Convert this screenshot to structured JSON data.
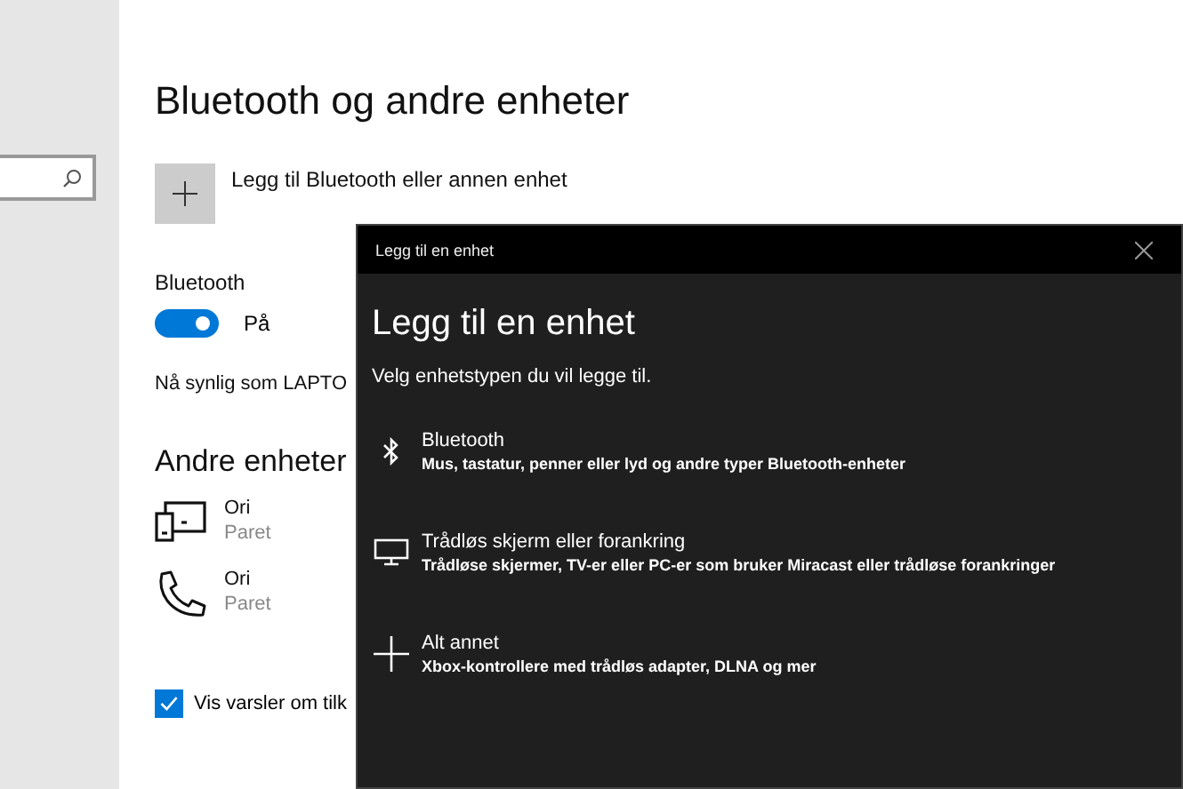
{
  "main": {
    "title": "Bluetooth og andre enheter",
    "add_device": {
      "label": "Legg til Bluetooth eller annen enhet"
    },
    "bluetooth": {
      "label": "Bluetooth",
      "on": true,
      "state_text": "På"
    },
    "visible_as": "Nå synlig som LAPTO",
    "other_devices": {
      "title": "Andre enheter",
      "items": [
        {
          "kind": "tablet",
          "name": "Ori",
          "status": "Paret"
        },
        {
          "kind": "phone",
          "name": "Ori",
          "status": "Paret"
        }
      ]
    },
    "notifications": {
      "label": "Vis varsler om tilk",
      "checked": true
    }
  },
  "dialog": {
    "title": "Legg til en enhet",
    "heading": "Legg til en enhet",
    "subtitle": "Velg enhetstypen du vil legge til.",
    "options": [
      {
        "kind": "bluetooth",
        "title": "Bluetooth",
        "description": "Mus, tastatur, penner eller lyd og andre typer Bluetooth-enheter"
      },
      {
        "kind": "display",
        "title": "Trådløs skjerm eller forankring",
        "description": "Trådløse skjermer, TV-er eller PC-er som bruker Miracast eller trådløse forankringer"
      },
      {
        "kind": "plus",
        "title": "Alt annet",
        "description": "Xbox-kontrollere med trådløs adapter, DLNA og mer"
      }
    ]
  }
}
